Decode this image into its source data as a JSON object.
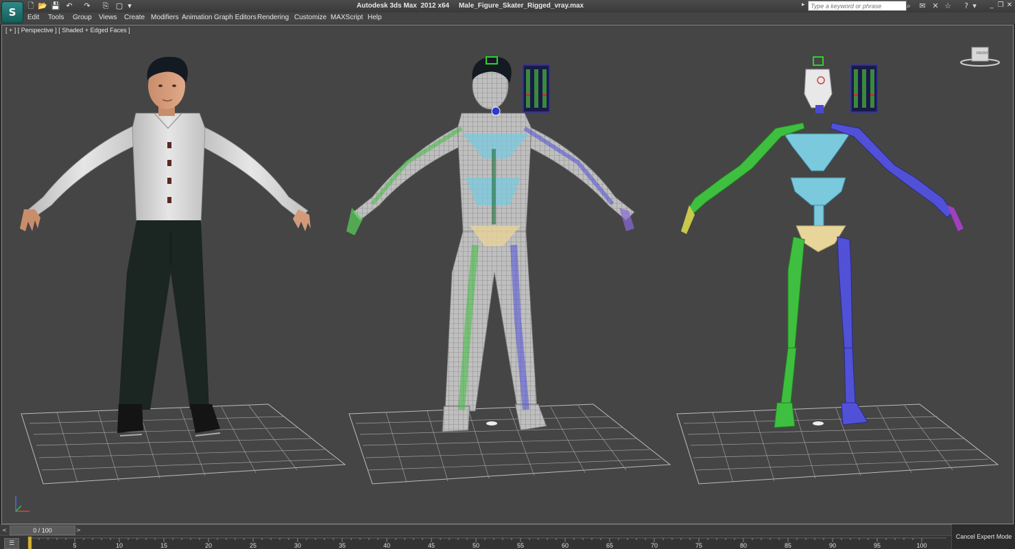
{
  "app": {
    "logo_text": "S",
    "title": "Autodesk 3ds Max  2012 x64     Male_Figure_Skater_Rigged_vray.max"
  },
  "quick_access": {
    "new": "🗋",
    "open": "📂",
    "save": "💾",
    "undo": "↶",
    "redo": "↷",
    "project": "⎘",
    "window_crossing": "▢",
    "dropdown": "▾"
  },
  "search": {
    "placeholder": "Type a keyword or phrase",
    "arrow": "▸"
  },
  "toolbar_right": {
    "binoculars": "⌕",
    "communication": "✉",
    "exchange": "✕",
    "favorites": "☆",
    "help": "?",
    "help_dropdown": "▾"
  },
  "window_controls": {
    "minimize": "_",
    "restore": "❐",
    "close": "✕"
  },
  "menu": [
    {
      "label": "Edit"
    },
    {
      "label": "Tools"
    },
    {
      "label": "Group"
    },
    {
      "label": "Views"
    },
    {
      "label": "Create"
    },
    {
      "label": "Modifiers"
    },
    {
      "label": "Animation"
    },
    {
      "label": "Graph Editors"
    },
    {
      "label": "Rendering"
    },
    {
      "label": "Customize"
    },
    {
      "label": "MAXScript"
    },
    {
      "label": "Help"
    }
  ],
  "viewport": {
    "label": "[ + ] [ Perspective ] [ Shaded + Edged Faces ]",
    "viewcube_face": "FRONT",
    "background": "#454545"
  },
  "time_slider": {
    "prev": "<",
    "value": "0 / 100",
    "next": ">",
    "current_frame": 0,
    "total_frames": 100
  },
  "track_bar": {
    "icon": "☰",
    "ticks": [
      5,
      10,
      15,
      20,
      25,
      30,
      35,
      40,
      45,
      50,
      55,
      60,
      65,
      70,
      75,
      80,
      85,
      90,
      95,
      100
    ]
  },
  "status": {
    "cancel_expert": "Cancel Expert Mode"
  },
  "colors": {
    "biped_left": "#3fbf3f",
    "biped_right": "#5151d8",
    "biped_spine": "#7ac9dd",
    "biped_pelvis": "#e8d59a",
    "shirt": "#d9d9d9",
    "pants": "#1a2320"
  }
}
